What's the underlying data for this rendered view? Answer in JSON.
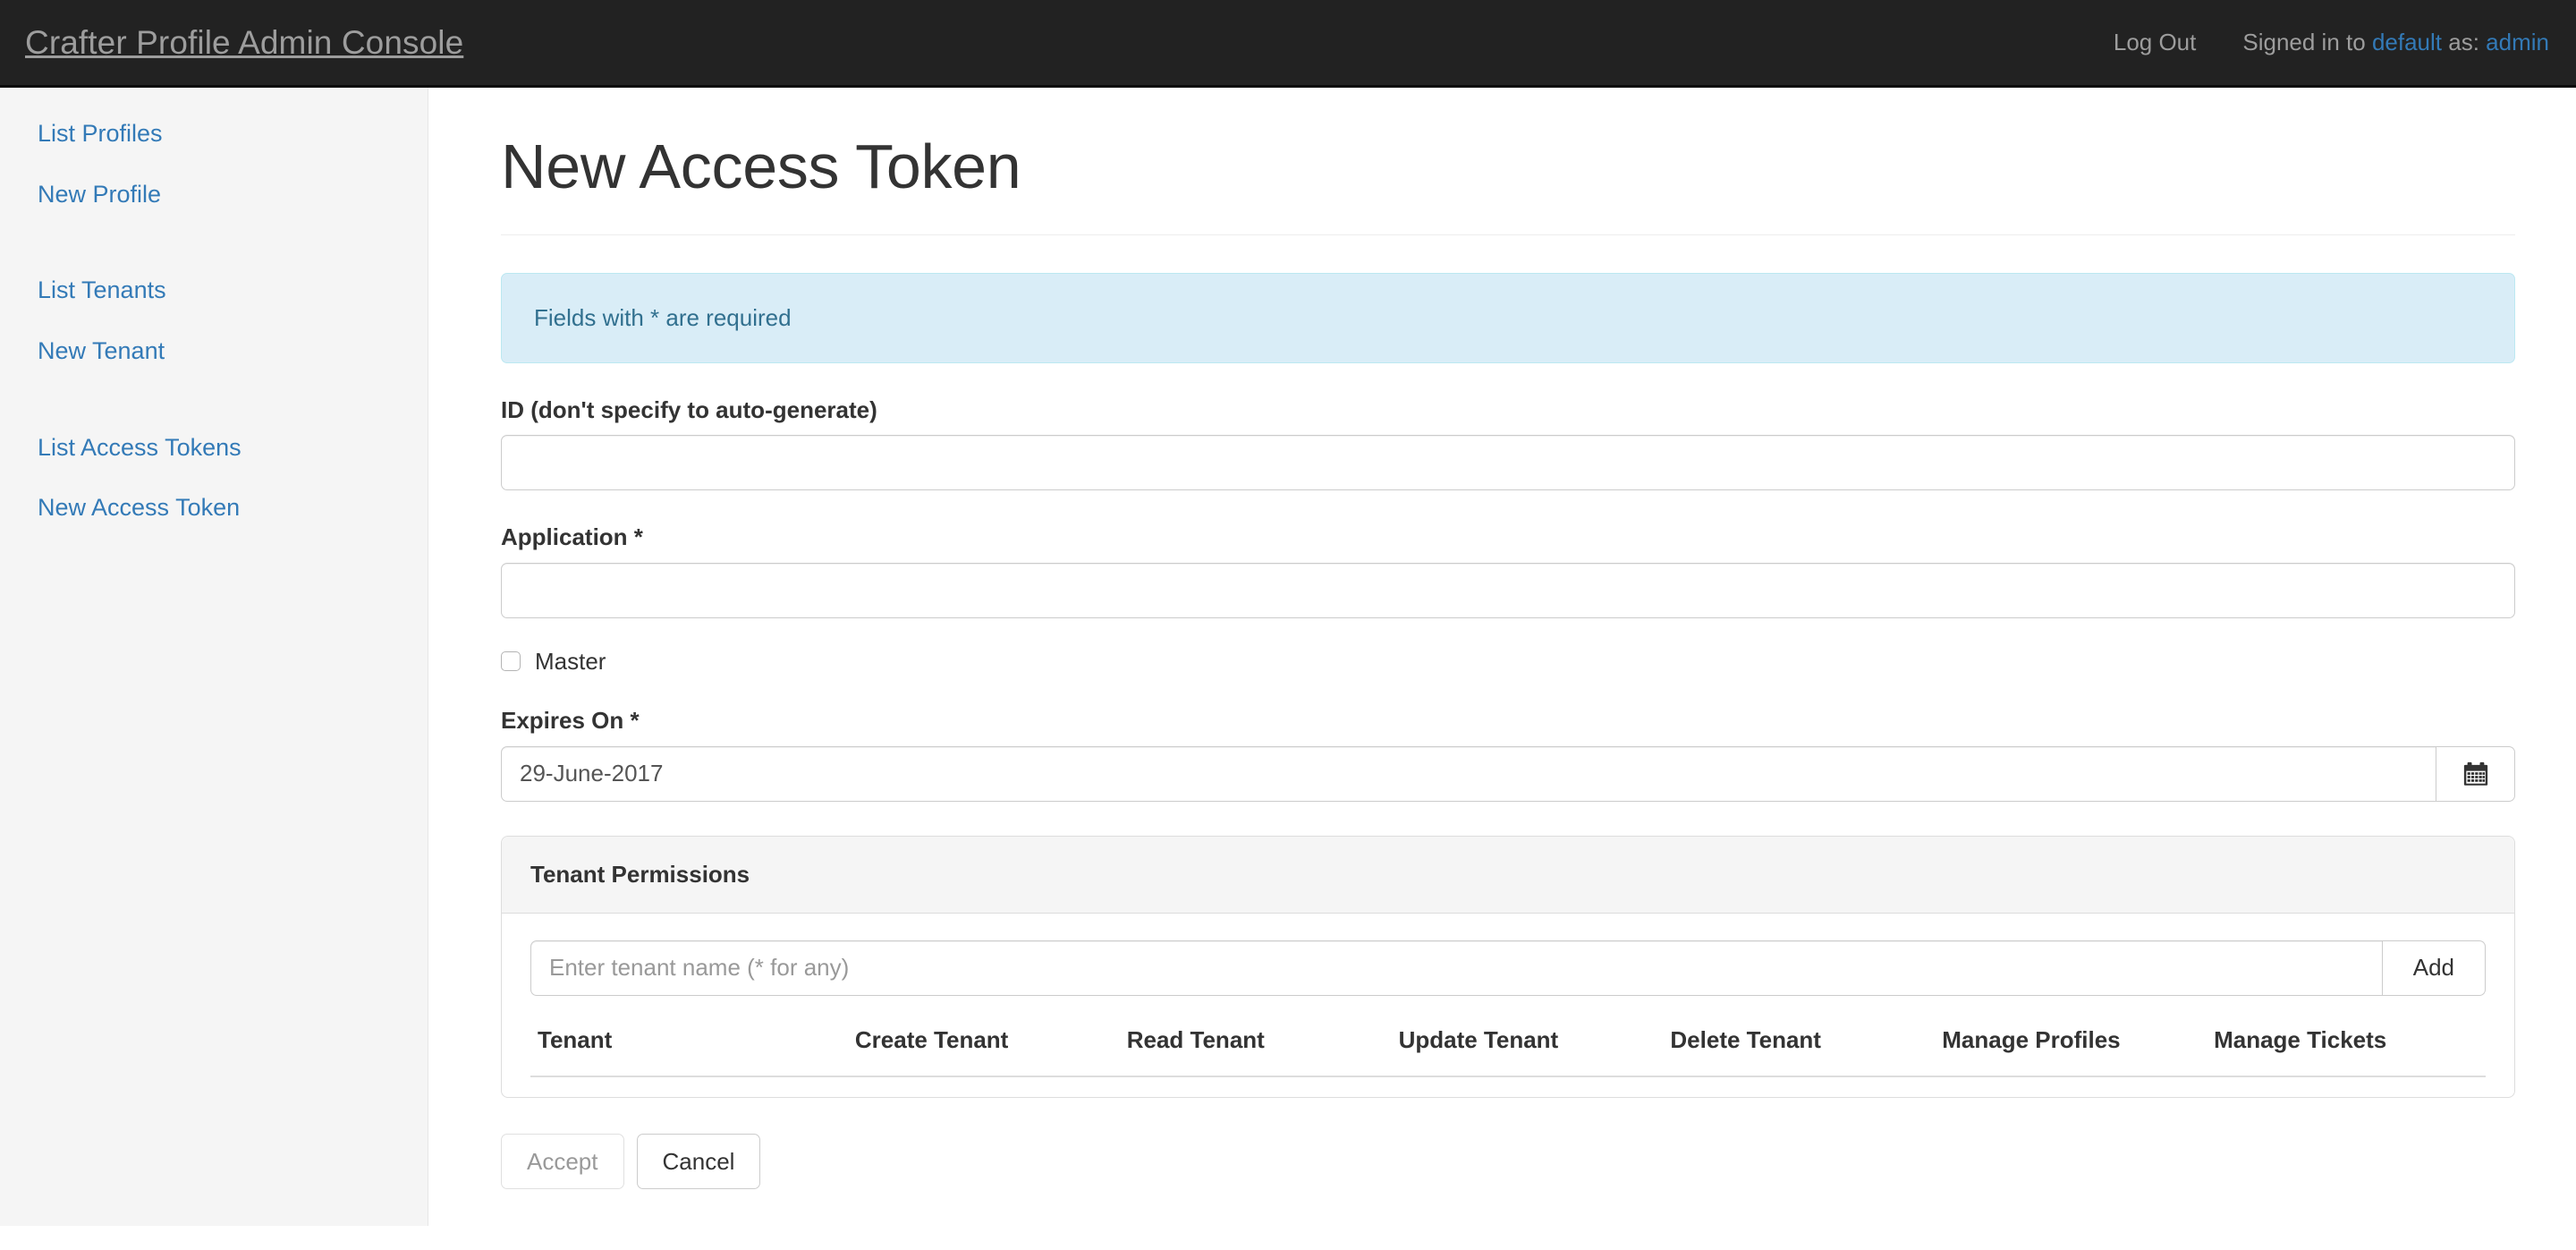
{
  "navbar": {
    "brand": "Crafter Profile Admin Console",
    "logout_label": "Log Out",
    "signed_in_prefix": "Signed in to",
    "tenant": "default",
    "as_label": "as:",
    "user": "admin",
    "background": "#222222",
    "text_color": "#9d9d9d",
    "link_color": "#337ab7"
  },
  "sidebar": {
    "groups": [
      {
        "items": [
          {
            "label": "List Profiles",
            "name": "sidebar-item-list-profiles"
          },
          {
            "label": "New Profile",
            "name": "sidebar-item-new-profile"
          }
        ]
      },
      {
        "items": [
          {
            "label": "List Tenants",
            "name": "sidebar-item-list-tenants"
          },
          {
            "label": "New Tenant",
            "name": "sidebar-item-new-tenant"
          }
        ]
      },
      {
        "items": [
          {
            "label": "List Access Tokens",
            "name": "sidebar-item-list-access-tokens"
          },
          {
            "label": "New Access Token",
            "name": "sidebar-item-new-access-token"
          }
        ]
      }
    ],
    "link_color": "#337ab7",
    "background": "#f5f5f5"
  },
  "main": {
    "page_title": "New Access Token",
    "alert": {
      "text": "Fields with * are required",
      "background": "#d9edf7",
      "border": "#bce8f1",
      "text_color": "#31708f"
    },
    "fields": {
      "id": {
        "label": "ID (don't specify to auto-generate)",
        "value": "",
        "placeholder": ""
      },
      "application": {
        "label": "Application *",
        "value": "",
        "placeholder": ""
      },
      "master": {
        "label": "Master",
        "checked": false
      },
      "expires_on": {
        "label": "Expires On *",
        "value": "29-June-2017",
        "placeholder": "",
        "calendar_icon": "calendar-icon"
      }
    },
    "tenant_permissions": {
      "panel_title": "Tenant Permissions",
      "tenant_input": {
        "value": "",
        "placeholder": "Enter tenant name (* for any)"
      },
      "add_label": "Add",
      "columns": [
        "Tenant",
        "Create Tenant",
        "Read Tenant",
        "Update Tenant",
        "Delete Tenant",
        "Manage Profiles",
        "Manage Tickets"
      ],
      "rows": []
    },
    "buttons": {
      "accept": {
        "label": "Accept",
        "disabled": true
      },
      "cancel": {
        "label": "Cancel",
        "disabled": false
      }
    }
  }
}
